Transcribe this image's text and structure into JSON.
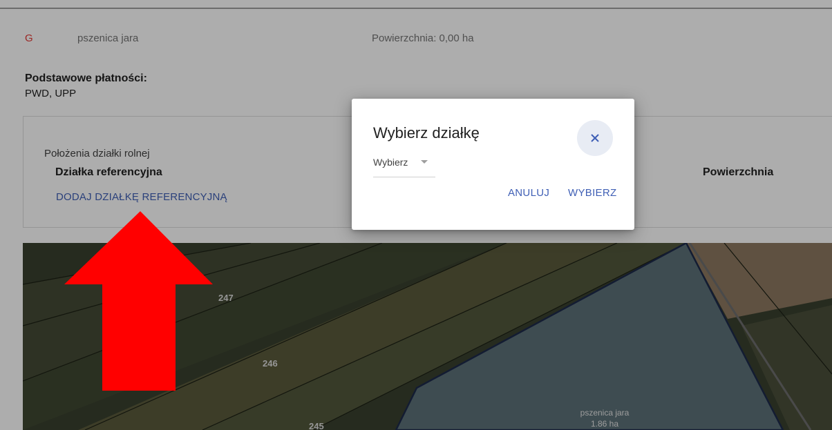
{
  "record": {
    "group_letter": "G",
    "crop_name": "pszenica jara",
    "area_label": "Powierzchnia: 0,00 ha"
  },
  "payments": {
    "title": "Podstawowe płatności:",
    "value": "PWD, UPP"
  },
  "location": {
    "title": "Położenia działki rolnej",
    "ref_column_header": "Działka referencyjna",
    "area_column_header": "Powierzchnia",
    "add_ref_link": "DODAJ DZIAŁKĘ REFERENCYJNĄ"
  },
  "map": {
    "parcel_labels": [
      "247",
      "246",
      "245"
    ],
    "field_label_crop": "pszenica jara",
    "field_label_area": "1.86 ha"
  },
  "dialog": {
    "title": "Wybierz działkę",
    "select_placeholder": "Wybierz",
    "cancel_label": "ANULUJ",
    "confirm_label": "WYBIERZ"
  },
  "icons": {
    "close": "close-icon",
    "dropdown": "chevron-down-icon",
    "annotation": "red-arrow-up"
  },
  "colors": {
    "accent": "#3f5fb5",
    "group_letter": "#e53935",
    "annotation_arrow": "#ff0000",
    "close_button_bg": "#e8ecf4"
  }
}
